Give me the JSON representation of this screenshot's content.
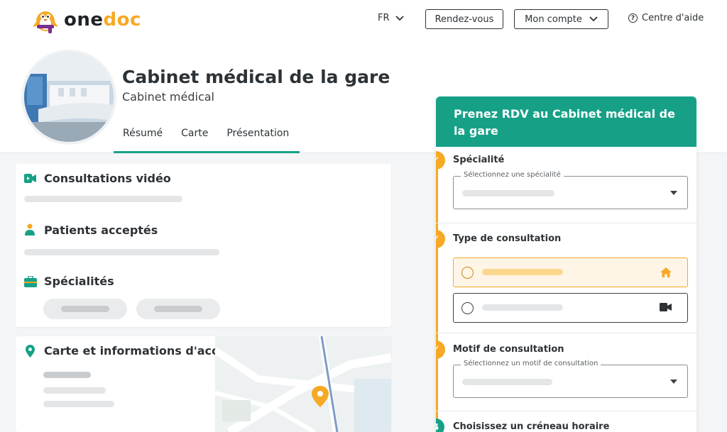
{
  "header": {
    "logo_part1": "one",
    "logo_part2": "doc",
    "language": "FR",
    "appointments_button": "Rendez-vous",
    "account_button": "Mon compte",
    "help_link": "Centre d'aide"
  },
  "profile": {
    "name": "Cabinet médical de la gare",
    "type": "Cabinet médical",
    "tabs": [
      {
        "label": "Résumé"
      },
      {
        "label": "Carte"
      },
      {
        "label": "Présentation"
      }
    ]
  },
  "sections": {
    "video": "Consultations vidéo",
    "patients": "Patients acceptés",
    "specialties": "Spécialités",
    "map": "Carte et informations d'accès"
  },
  "booking": {
    "title": "Prenez RDV au Cabinet médical de la gare",
    "steps": [
      {
        "title": "Spécialité",
        "select_label": "Sélectionnez une spécialité"
      },
      {
        "title": "Type de consultation"
      },
      {
        "title": "Motif de consultation",
        "select_label": "Sélectionnez un motif de consultation"
      },
      {
        "number": "4",
        "title": "Choisissez un créneau horaire"
      }
    ],
    "check_mark": "✓"
  },
  "colors": {
    "brand_green": "#16a187",
    "brand_orange": "#f6a924"
  },
  "icons": {
    "video_section": "video-camera-icon",
    "patients_section": "person-icon",
    "specialties_section": "briefcase-icon",
    "map_section": "location-pin-icon",
    "home_option": "home-icon",
    "video_option": "video-camera-icon"
  }
}
